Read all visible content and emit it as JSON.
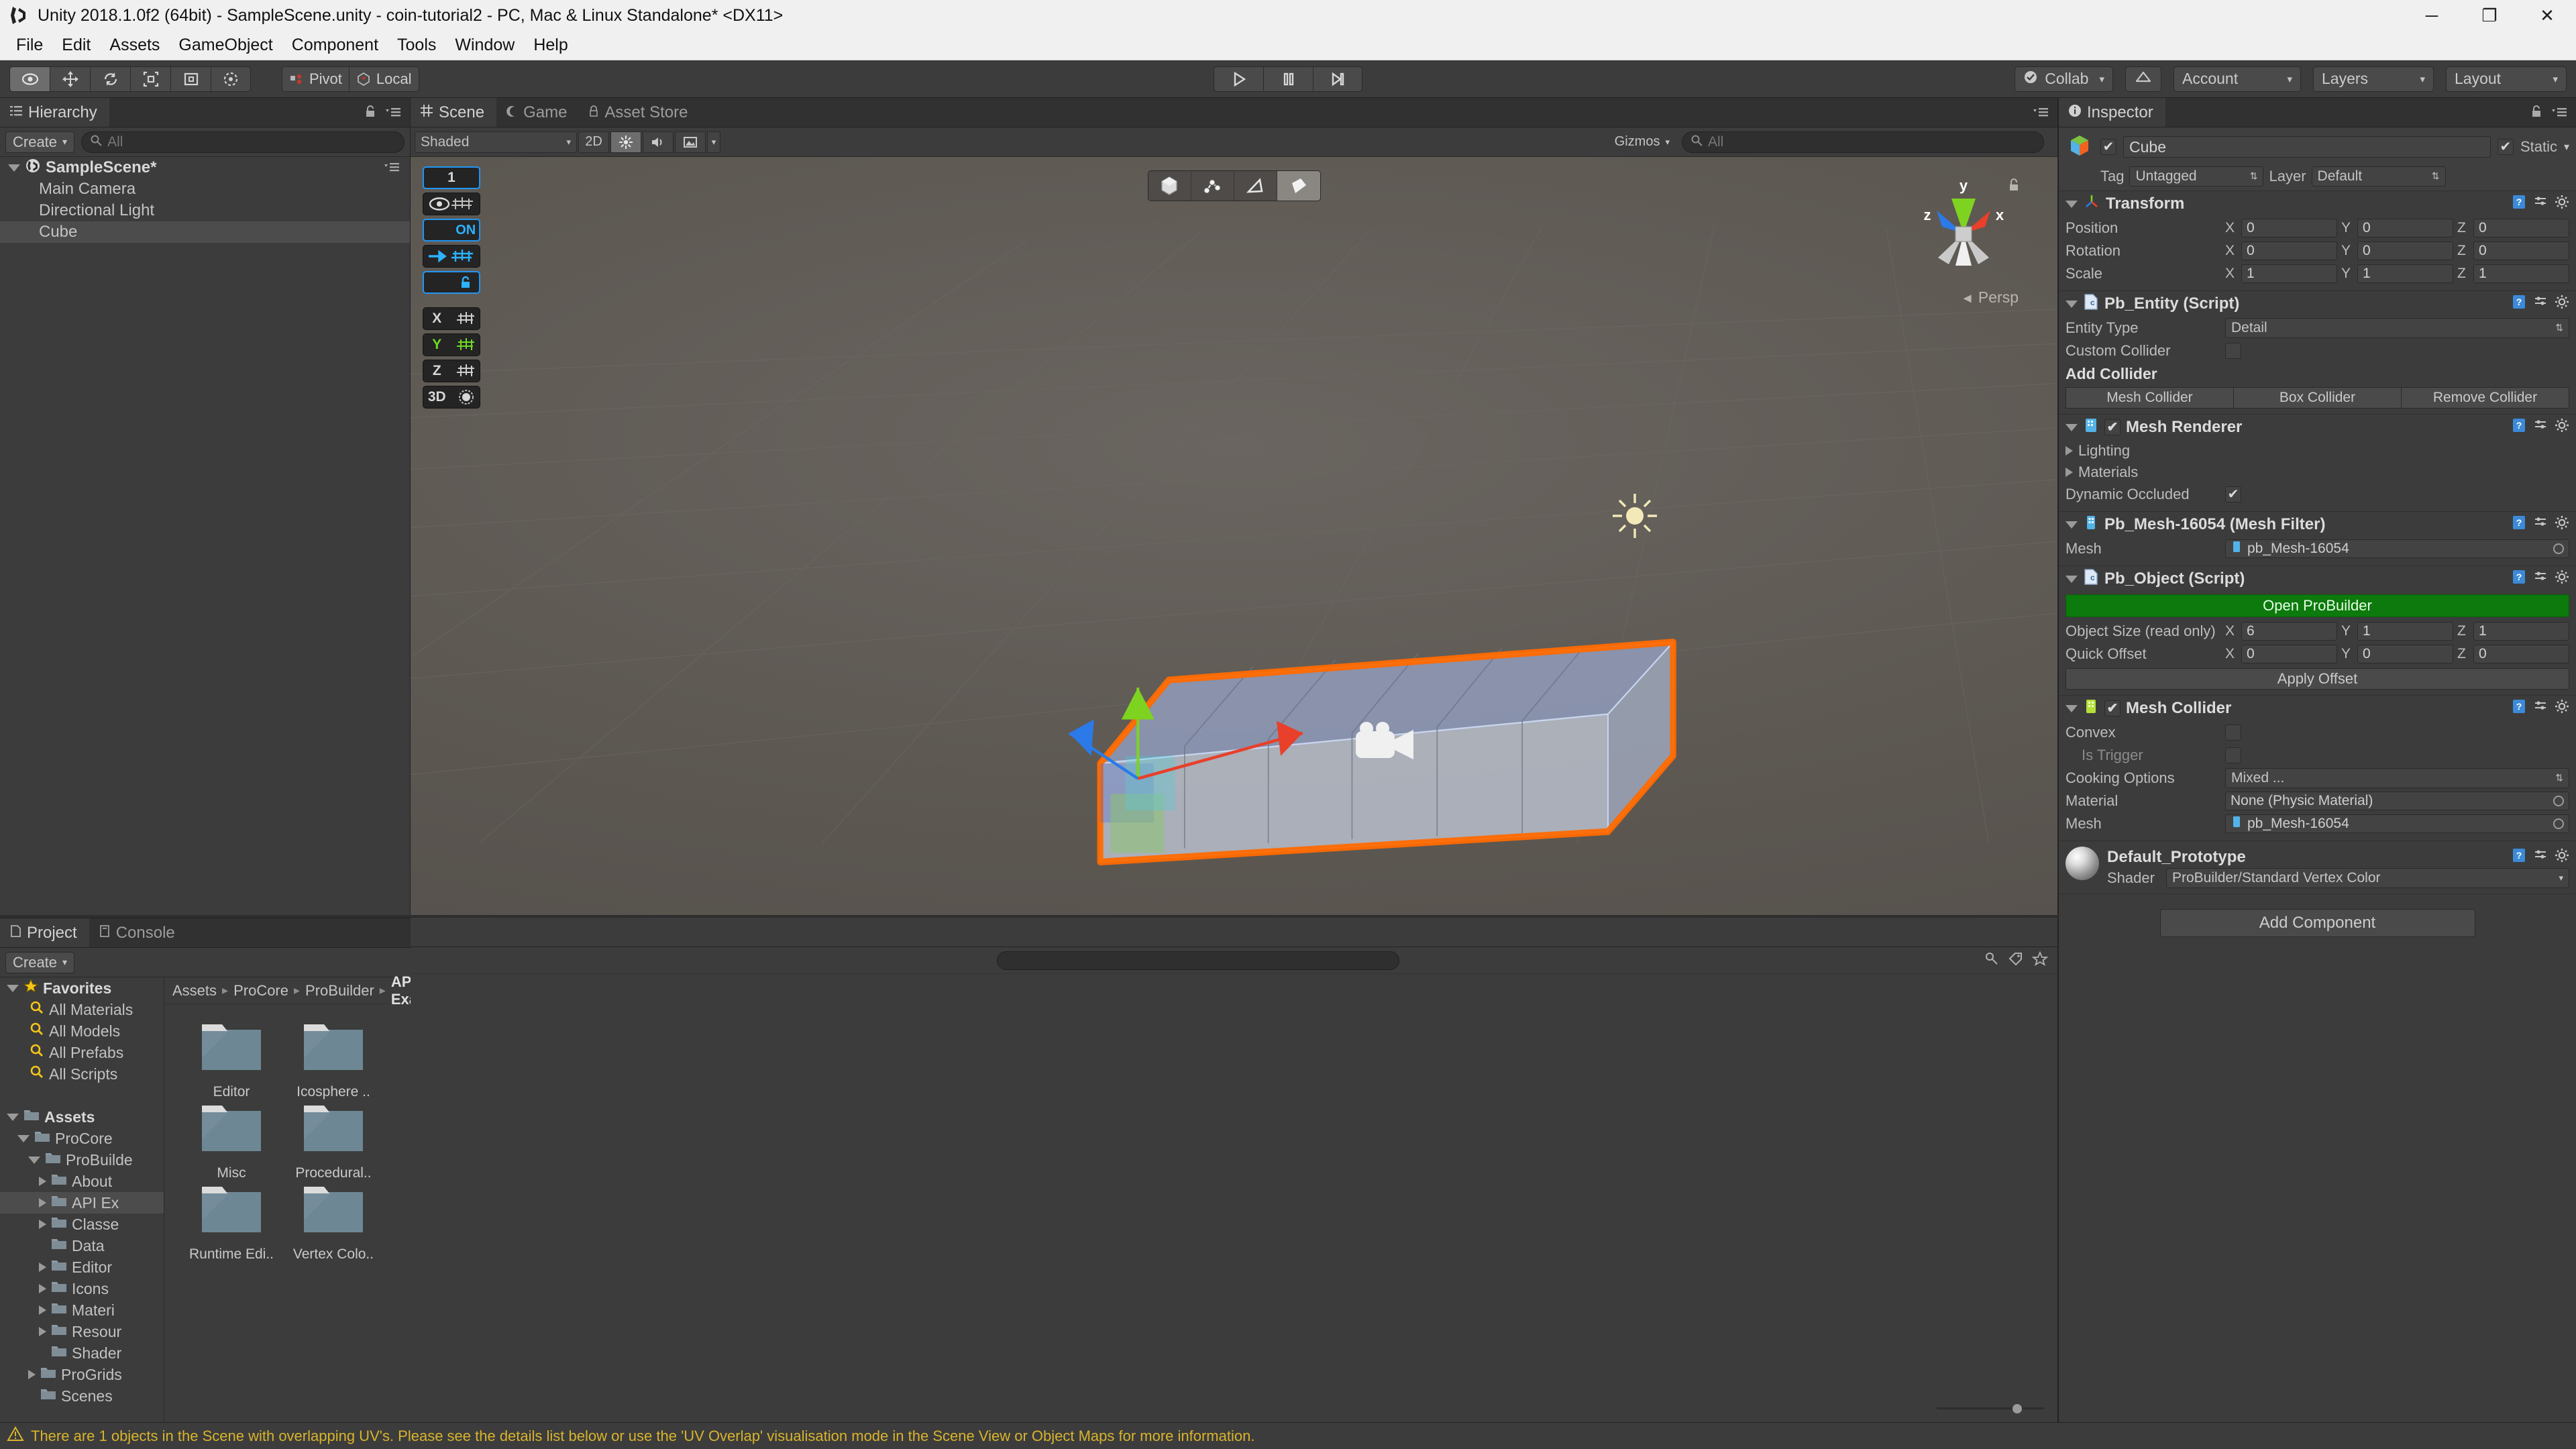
{
  "window": {
    "title": "Unity 2018.1.0f2 (64bit) - SampleScene.unity - coin-tutorial2 - PC, Mac & Linux Standalone* <DX11>",
    "minimize": "─",
    "maximize": "❐",
    "close": "✕"
  },
  "menubar": {
    "items": [
      "File",
      "Edit",
      "Assets",
      "GameObject",
      "Component",
      "Tools",
      "Window",
      "Help"
    ]
  },
  "toolbar": {
    "transform_tools": [
      "hand-tool",
      "move-tool",
      "rotate-tool",
      "scale-tool",
      "rect-tool",
      "transform-tool"
    ],
    "pivot_label": "Pivot",
    "local_label": "Local",
    "play": "▶",
    "pause": "❙❙",
    "step": "▶|",
    "collab_label": "Collab",
    "cloud_label": "cloud-icon",
    "account_label": "Account",
    "layers_label": "Layers",
    "layout_label": "Layout",
    "caret": "▾"
  },
  "hierarchy": {
    "tab_label": "Hierarchy",
    "create_label": "Create",
    "search_placeholder": "All",
    "scene_name": "SampleScene*",
    "items": [
      {
        "label": "Main Camera",
        "selected": false
      },
      {
        "label": "Directional Light",
        "selected": false
      },
      {
        "label": "Cube",
        "selected": true
      }
    ]
  },
  "scene": {
    "tabs": [
      {
        "label": "Scene",
        "active": true
      },
      {
        "label": "Game",
        "active": false
      },
      {
        "label": "Asset Store",
        "active": false
      }
    ],
    "draw_mode": "Shaded",
    "two_d_label": "2D",
    "lighting_icon": "light-toggle-icon",
    "audio_icon": "audio-toggle-icon",
    "effects_icon": "effects-toggle-icon",
    "gizmos_label": "Gizmos",
    "gizmos_search_placeholder": "All",
    "persp_label": "Persp",
    "gizmo_axes": {
      "x": "x",
      "y": "y",
      "z": "z"
    },
    "progrids": {
      "snap_value": "1",
      "on_label": "ON",
      "axes": [
        "X",
        "Y",
        "Z"
      ],
      "active_axis": "Y",
      "three_d_label": "3D"
    },
    "element_modes": [
      {
        "name": "object-mode",
        "active": false
      },
      {
        "name": "vertex-mode",
        "active": false
      },
      {
        "name": "edge-mode",
        "active": false
      },
      {
        "name": "face-mode",
        "active": true
      }
    ]
  },
  "project": {
    "tabs": [
      {
        "label": "Project",
        "active": true
      },
      {
        "label": "Console",
        "active": false
      }
    ],
    "create_label": "Create",
    "breadcrumb": [
      "Assets",
      "ProCore",
      "ProBuilder",
      "API Examples"
    ],
    "tree": [
      {
        "label": "Favorites",
        "depth": 0,
        "icon": "star-icon",
        "arrow": "open",
        "bold": true,
        "selected": false
      },
      {
        "label": "All Materials",
        "depth": 1,
        "icon": "search-icon",
        "arrow": "none",
        "bold": false,
        "selected": false
      },
      {
        "label": "All Models",
        "depth": 1,
        "icon": "search-icon",
        "arrow": "none",
        "bold": false,
        "selected": false
      },
      {
        "label": "All Prefabs",
        "depth": 1,
        "icon": "search-icon",
        "arrow": "none",
        "bold": false,
        "selected": false
      },
      {
        "label": "All Scripts",
        "depth": 1,
        "icon": "search-icon",
        "arrow": "none",
        "bold": false,
        "selected": false
      },
      {
        "label": "",
        "depth": 0,
        "icon": "none",
        "arrow": "none",
        "bold": false,
        "selected": false
      },
      {
        "label": "Assets",
        "depth": 0,
        "icon": "folder-icon",
        "arrow": "open",
        "bold": true,
        "selected": false
      },
      {
        "label": "ProCore",
        "depth": 1,
        "icon": "folder-icon",
        "arrow": "open",
        "bold": false,
        "selected": false
      },
      {
        "label": "ProBuilde",
        "depth": 2,
        "icon": "folder-icon",
        "arrow": "open",
        "bold": false,
        "selected": false
      },
      {
        "label": "About",
        "depth": 3,
        "icon": "folder-icon",
        "arrow": "closed",
        "bold": false,
        "selected": false
      },
      {
        "label": "API Ex",
        "depth": 3,
        "icon": "folder-icon",
        "arrow": "closed",
        "bold": false,
        "selected": true
      },
      {
        "label": "Classe",
        "depth": 3,
        "icon": "folder-icon",
        "arrow": "closed",
        "bold": false,
        "selected": false
      },
      {
        "label": "Data",
        "depth": 3,
        "icon": "folder-icon",
        "arrow": "none",
        "bold": false,
        "selected": false
      },
      {
        "label": "Editor",
        "depth": 3,
        "icon": "folder-icon",
        "arrow": "closed",
        "bold": false,
        "selected": false
      },
      {
        "label": "Icons",
        "depth": 3,
        "icon": "folder-icon",
        "arrow": "closed",
        "bold": false,
        "selected": false
      },
      {
        "label": "Materi",
        "depth": 3,
        "icon": "folder-icon",
        "arrow": "closed",
        "bold": false,
        "selected": false
      },
      {
        "label": "Resour",
        "depth": 3,
        "icon": "folder-icon",
        "arrow": "closed",
        "bold": false,
        "selected": false
      },
      {
        "label": "Shader",
        "depth": 3,
        "icon": "folder-icon",
        "arrow": "none",
        "bold": false,
        "selected": false
      },
      {
        "label": "ProGrids",
        "depth": 2,
        "icon": "folder-icon",
        "arrow": "closed",
        "bold": false,
        "selected": false
      },
      {
        "label": "Scenes",
        "depth": 2,
        "icon": "folder-icon",
        "arrow": "none",
        "bold": false,
        "selected": false
      }
    ],
    "folders": [
      {
        "label": "Editor"
      },
      {
        "label": "Icosphere .."
      },
      {
        "label": "Misc"
      },
      {
        "label": "Procedural.."
      },
      {
        "label": "Runtime Edi.."
      },
      {
        "label": "Vertex Colo.."
      }
    ]
  },
  "inspector": {
    "tab_label": "Inspector",
    "object_name": "Cube",
    "object_enabled": true,
    "static_label": "Static",
    "static_checked": true,
    "tag_label": "Tag",
    "tag_value": "Untagged",
    "layer_label": "Layer",
    "layer_value": "Default",
    "transform": {
      "title": "Transform",
      "rows": [
        {
          "label": "Position",
          "x": "0",
          "y": "0",
          "z": "0"
        },
        {
          "label": "Rotation",
          "x": "0",
          "y": "0",
          "z": "0"
        },
        {
          "label": "Scale",
          "x": "1",
          "y": "1",
          "z": "1"
        }
      ]
    },
    "pb_entity": {
      "title": "Pb_Entity (Script)",
      "entity_type_label": "Entity Type",
      "entity_type_value": "Detail",
      "custom_collider_label": "Custom Collider",
      "custom_collider_checked": false,
      "add_collider_label": "Add Collider",
      "buttons": [
        "Mesh Collider",
        "Box Collider",
        "Remove Collider"
      ]
    },
    "mesh_renderer": {
      "title": "Mesh Renderer",
      "enabled": true,
      "lighting_label": "Lighting",
      "materials_label": "Materials",
      "dynamic_occluded_label": "Dynamic Occluded",
      "dynamic_occluded_checked": true
    },
    "mesh_filter": {
      "title": "Pb_Mesh-16054 (Mesh Filter)",
      "mesh_label": "Mesh",
      "mesh_value": "pb_Mesh-16054"
    },
    "pb_object": {
      "title": "Pb_Object (Script)",
      "open_probuilder_label": "Open ProBuilder",
      "object_size_label": "Object Size (read only)",
      "object_size": {
        "x": "6",
        "y": "1",
        "z": "1"
      },
      "quick_offset_label": "Quick Offset",
      "quick_offset": {
        "x": "0",
        "y": "0",
        "z": "0"
      },
      "apply_offset_label": "Apply Offset"
    },
    "mesh_collider": {
      "title": "Mesh Collider",
      "enabled": true,
      "convex_label": "Convex",
      "convex_checked": false,
      "is_trigger_label": "Is Trigger",
      "is_trigger_checked": false,
      "cooking_options_label": "Cooking Options",
      "cooking_options_value": "Mixed ...",
      "material_label": "Material",
      "material_value": "None (Physic Material)",
      "mesh_label": "Mesh",
      "mesh_value": "pb_Mesh-16054"
    },
    "material": {
      "title": "Default_Prototype",
      "shader_label": "Shader",
      "shader_value": "ProBuilder/Standard Vertex Color"
    },
    "add_component_label": "Add Component"
  },
  "statusbar": {
    "message": "There are 1 objects in the Scene with overlapping UV's. Please see the details list below or use the 'UV Overlap' visualisation mode in the Scene View or Object Maps for more information.",
    "icon": "warning-icon",
    "color": "#d8b42c"
  },
  "colors": {
    "selection_outline": "#ff6a00",
    "accent_blue": "#2196f3",
    "axis_x": "#e8402a",
    "axis_y": "#7ed320",
    "axis_z": "#2b7ae8",
    "probuilder_green": "#0c7a0c",
    "warning": "#d8b42c"
  }
}
